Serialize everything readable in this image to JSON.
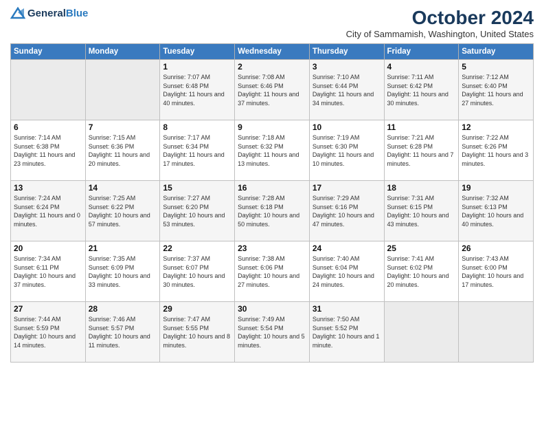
{
  "logo": {
    "line1": "General",
    "line2": "Blue"
  },
  "title": "October 2024",
  "subtitle": "City of Sammamish, Washington, United States",
  "weekdays": [
    "Sunday",
    "Monday",
    "Tuesday",
    "Wednesday",
    "Thursday",
    "Friday",
    "Saturday"
  ],
  "weeks": [
    [
      {
        "day": "",
        "info": ""
      },
      {
        "day": "",
        "info": ""
      },
      {
        "day": "1",
        "info": "Sunrise: 7:07 AM\nSunset: 6:48 PM\nDaylight: 11 hours and 40 minutes."
      },
      {
        "day": "2",
        "info": "Sunrise: 7:08 AM\nSunset: 6:46 PM\nDaylight: 11 hours and 37 minutes."
      },
      {
        "day": "3",
        "info": "Sunrise: 7:10 AM\nSunset: 6:44 PM\nDaylight: 11 hours and 34 minutes."
      },
      {
        "day": "4",
        "info": "Sunrise: 7:11 AM\nSunset: 6:42 PM\nDaylight: 11 hours and 30 minutes."
      },
      {
        "day": "5",
        "info": "Sunrise: 7:12 AM\nSunset: 6:40 PM\nDaylight: 11 hours and 27 minutes."
      }
    ],
    [
      {
        "day": "6",
        "info": "Sunrise: 7:14 AM\nSunset: 6:38 PM\nDaylight: 11 hours and 23 minutes."
      },
      {
        "day": "7",
        "info": "Sunrise: 7:15 AM\nSunset: 6:36 PM\nDaylight: 11 hours and 20 minutes."
      },
      {
        "day": "8",
        "info": "Sunrise: 7:17 AM\nSunset: 6:34 PM\nDaylight: 11 hours and 17 minutes."
      },
      {
        "day": "9",
        "info": "Sunrise: 7:18 AM\nSunset: 6:32 PM\nDaylight: 11 hours and 13 minutes."
      },
      {
        "day": "10",
        "info": "Sunrise: 7:19 AM\nSunset: 6:30 PM\nDaylight: 11 hours and 10 minutes."
      },
      {
        "day": "11",
        "info": "Sunrise: 7:21 AM\nSunset: 6:28 PM\nDaylight: 11 hours and 7 minutes."
      },
      {
        "day": "12",
        "info": "Sunrise: 7:22 AM\nSunset: 6:26 PM\nDaylight: 11 hours and 3 minutes."
      }
    ],
    [
      {
        "day": "13",
        "info": "Sunrise: 7:24 AM\nSunset: 6:24 PM\nDaylight: 11 hours and 0 minutes."
      },
      {
        "day": "14",
        "info": "Sunrise: 7:25 AM\nSunset: 6:22 PM\nDaylight: 10 hours and 57 minutes."
      },
      {
        "day": "15",
        "info": "Sunrise: 7:27 AM\nSunset: 6:20 PM\nDaylight: 10 hours and 53 minutes."
      },
      {
        "day": "16",
        "info": "Sunrise: 7:28 AM\nSunset: 6:18 PM\nDaylight: 10 hours and 50 minutes."
      },
      {
        "day": "17",
        "info": "Sunrise: 7:29 AM\nSunset: 6:16 PM\nDaylight: 10 hours and 47 minutes."
      },
      {
        "day": "18",
        "info": "Sunrise: 7:31 AM\nSunset: 6:15 PM\nDaylight: 10 hours and 43 minutes."
      },
      {
        "day": "19",
        "info": "Sunrise: 7:32 AM\nSunset: 6:13 PM\nDaylight: 10 hours and 40 minutes."
      }
    ],
    [
      {
        "day": "20",
        "info": "Sunrise: 7:34 AM\nSunset: 6:11 PM\nDaylight: 10 hours and 37 minutes."
      },
      {
        "day": "21",
        "info": "Sunrise: 7:35 AM\nSunset: 6:09 PM\nDaylight: 10 hours and 33 minutes."
      },
      {
        "day": "22",
        "info": "Sunrise: 7:37 AM\nSunset: 6:07 PM\nDaylight: 10 hours and 30 minutes."
      },
      {
        "day": "23",
        "info": "Sunrise: 7:38 AM\nSunset: 6:06 PM\nDaylight: 10 hours and 27 minutes."
      },
      {
        "day": "24",
        "info": "Sunrise: 7:40 AM\nSunset: 6:04 PM\nDaylight: 10 hours and 24 minutes."
      },
      {
        "day": "25",
        "info": "Sunrise: 7:41 AM\nSunset: 6:02 PM\nDaylight: 10 hours and 20 minutes."
      },
      {
        "day": "26",
        "info": "Sunrise: 7:43 AM\nSunset: 6:00 PM\nDaylight: 10 hours and 17 minutes."
      }
    ],
    [
      {
        "day": "27",
        "info": "Sunrise: 7:44 AM\nSunset: 5:59 PM\nDaylight: 10 hours and 14 minutes."
      },
      {
        "day": "28",
        "info": "Sunrise: 7:46 AM\nSunset: 5:57 PM\nDaylight: 10 hours and 11 minutes."
      },
      {
        "day": "29",
        "info": "Sunrise: 7:47 AM\nSunset: 5:55 PM\nDaylight: 10 hours and 8 minutes."
      },
      {
        "day": "30",
        "info": "Sunrise: 7:49 AM\nSunset: 5:54 PM\nDaylight: 10 hours and 5 minutes."
      },
      {
        "day": "31",
        "info": "Sunrise: 7:50 AM\nSunset: 5:52 PM\nDaylight: 10 hours and 1 minute."
      },
      {
        "day": "",
        "info": ""
      },
      {
        "day": "",
        "info": ""
      }
    ]
  ]
}
